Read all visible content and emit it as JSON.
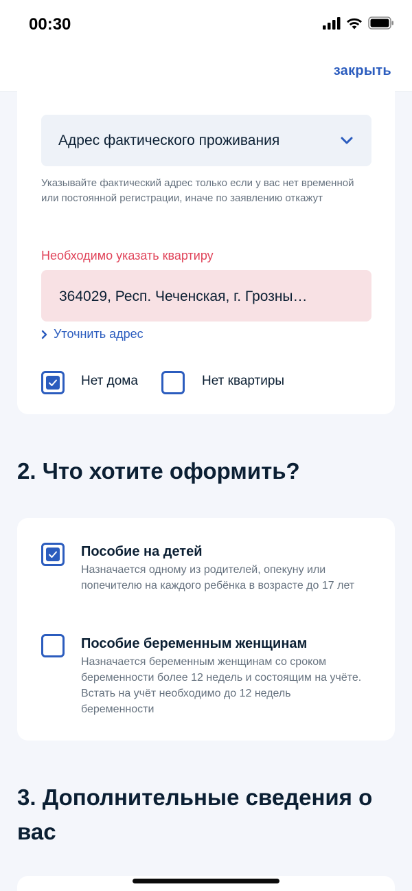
{
  "status_bar": {
    "time": "00:30",
    "icons": [
      "cellular-signal-icon",
      "wifi-icon",
      "battery-icon"
    ]
  },
  "nav": {
    "close_label": "закрыть"
  },
  "address_section": {
    "address_type_select": {
      "value": "Адрес фактического проживания",
      "icon": "chevron-down-icon"
    },
    "hint": "Указывайте фактический адрес только если у вас нет временной или постоянной регистрации, иначе по заявлению откажут",
    "error": "Необходимо указать квартиру",
    "address_value": "364029, Респ. Чеченская, г. Грозны…",
    "refine_link": "Уточнить адрес",
    "checkboxes": [
      {
        "label": "Нет дома",
        "checked": true
      },
      {
        "label": "Нет квартиры",
        "checked": false
      }
    ]
  },
  "section2": {
    "title": "2. Что хотите оформить?",
    "options": [
      {
        "title": "Пособие на детей",
        "description": "Назначается одному из родителей, опекуну или попечителю на каждого ребёнка в возрасте до 17 лет",
        "checked": true
      },
      {
        "title": "Пособие беременным женщинам",
        "description": "Назначается беременным женщинам со сроком беременности более 12 недель и состоящим на учёте. Встать на учёт необходимо до 12 недель беременности",
        "checked": false
      }
    ]
  },
  "section3": {
    "title": "3. Дополнительные сведения о вас"
  },
  "colors": {
    "accent": "#2b5cbe",
    "error": "#e0445a",
    "error_bg": "#f8e1e4",
    "field_bg": "#eef2f8",
    "page_bg": "#f4f6fb"
  }
}
